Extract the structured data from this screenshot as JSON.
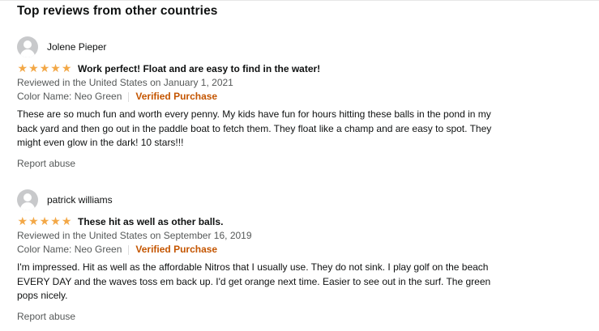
{
  "section": {
    "title": "Top reviews from other countries"
  },
  "reviews": [
    {
      "author": "Jolene Pieper",
      "rating": 5,
      "title": "Work perfect! Float and are easy to find in the water!",
      "date_line": "Reviewed in the United States on January 1, 2021",
      "variant": "Color Name: Neo Green",
      "verified": "Verified Purchase",
      "body": "These are so much fun and worth every penny. My kids have fun for hours hitting these balls in the pond in my back yard and then go out in the paddle boat to fetch them. They float like a champ and are easy to spot. They might even glow in the dark! 10 stars!!!",
      "report": "Report abuse"
    },
    {
      "author": "patrick williams",
      "rating": 5,
      "title": "These hit as well as other balls.",
      "date_line": "Reviewed in the United States on September 16, 2019",
      "variant": "Color Name: Neo Green",
      "verified": "Verified Purchase",
      "body": "I'm impressed. Hit as well as the affordable Nitros that I usually use. They do not sink. I play golf on the beach EVERY DAY and the waves toss em back up. I'd get orange next time. Easier to see out in the surf. The green pops nicely.",
      "report": "Report abuse"
    }
  ],
  "colors": {
    "star": "#f3a847",
    "verified": "#c45500",
    "meta": "#565959"
  },
  "icons": {
    "avatar": "default-avatar-icon",
    "star": "star-icon"
  }
}
